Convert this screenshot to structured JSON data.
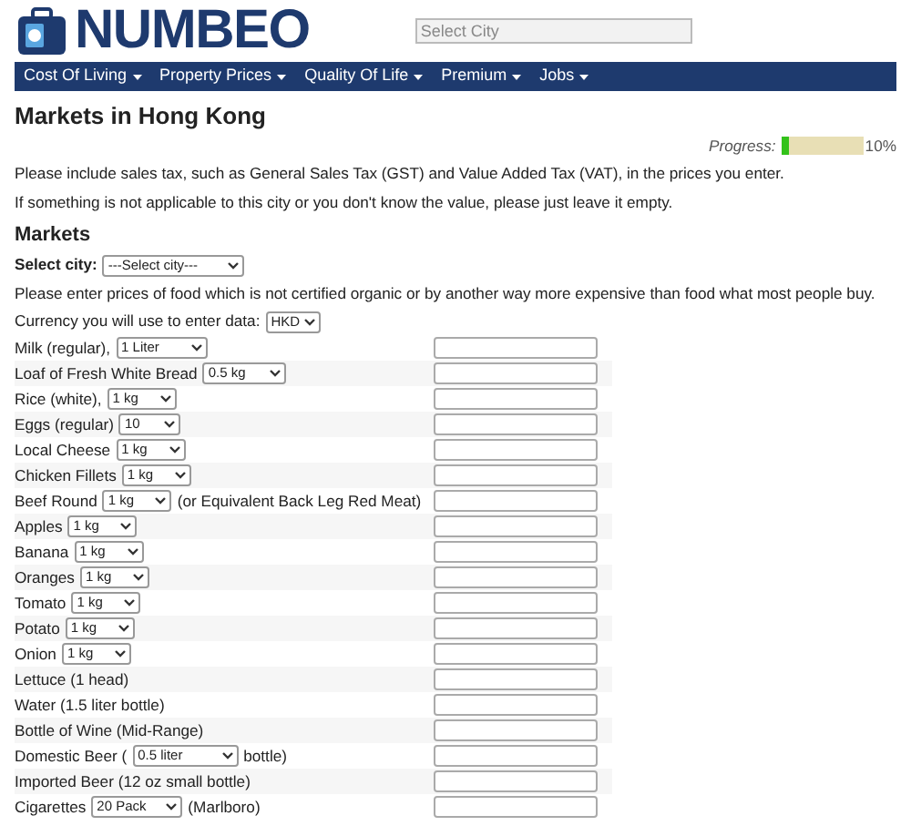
{
  "logo": {
    "text": "NUMBEO"
  },
  "search": {
    "placeholder": "Select City"
  },
  "nav": [
    {
      "label": "Cost Of Living"
    },
    {
      "label": "Property Prices"
    },
    {
      "label": "Quality Of Life"
    },
    {
      "label": "Premium"
    },
    {
      "label": "Jobs"
    }
  ],
  "title": "Markets in Hong Kong",
  "progress": {
    "label": "Progress:",
    "level": 0.1,
    "reading": "10%"
  },
  "notes": [
    "Please include sales tax, such as General Sales Tax (GST) and Value Added Tax (VAT), in the prices you enter.",
    "If something is not applicable to this city or you don't know the value, please just leave it empty."
  ],
  "section": "Markets",
  "select_city": {
    "label": "Select city:",
    "value": "---Select city---"
  },
  "food_note": "Please enter prices of food which is not certified organic or by another way more expensive than food what most people buy.",
  "currency": {
    "label": "Currency you will use to enter data:",
    "value": "HKD"
  },
  "items": [
    {
      "label": "Milk (regular),",
      "unit": "1 Liter"
    },
    {
      "label": "Loaf of Fresh White Bread",
      "unit": "0.5 kg"
    },
    {
      "label": "Rice (white),",
      "unit": "1 kg"
    },
    {
      "label": "Eggs (regular)",
      "unit": "10"
    },
    {
      "label": "Local Cheese",
      "unit": "1 kg"
    },
    {
      "label": "Chicken Fillets",
      "unit": "1 kg"
    },
    {
      "label": "Beef Round",
      "unit": "1 kg",
      "suffix": "(or Equivalent Back Leg Red Meat)"
    },
    {
      "label": "Apples",
      "unit": "1 kg"
    },
    {
      "label": "Banana",
      "unit": "1 kg"
    },
    {
      "label": "Oranges",
      "unit": "1 kg"
    },
    {
      "label": "Tomato",
      "unit": "1 kg"
    },
    {
      "label": "Potato",
      "unit": "1 kg"
    },
    {
      "label": "Onion",
      "unit": "1 kg"
    },
    {
      "label": "Lettuce (1 head)"
    },
    {
      "label": "Water (1.5 liter bottle)"
    },
    {
      "label": "Bottle of Wine (Mid-Range)"
    },
    {
      "label": "Domestic Beer (",
      "unit": "0.5 liter",
      "suffix": "bottle)"
    },
    {
      "label": "Imported Beer (12 oz small bottle)"
    },
    {
      "label": "Cigarettes",
      "unit": "20 Pack",
      "suffix": "(Marlboro)"
    }
  ]
}
